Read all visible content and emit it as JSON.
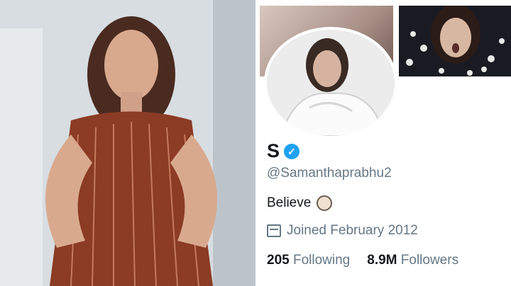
{
  "profile": {
    "name": "S",
    "handle": "@Samanthaprabhu2",
    "bio": "Believe",
    "joined": "Joined February 2012",
    "following_count": "205",
    "following_label": "Following",
    "followers_count": "8.9M",
    "followers_label": "Followers"
  },
  "icons": {
    "verified": "verified-badge-icon",
    "calendar": "calendar-icon",
    "bio_emoji": "emoji-icon"
  },
  "colors": {
    "accent": "#1da1f2",
    "text_primary": "#14171a",
    "text_secondary": "#657786"
  }
}
